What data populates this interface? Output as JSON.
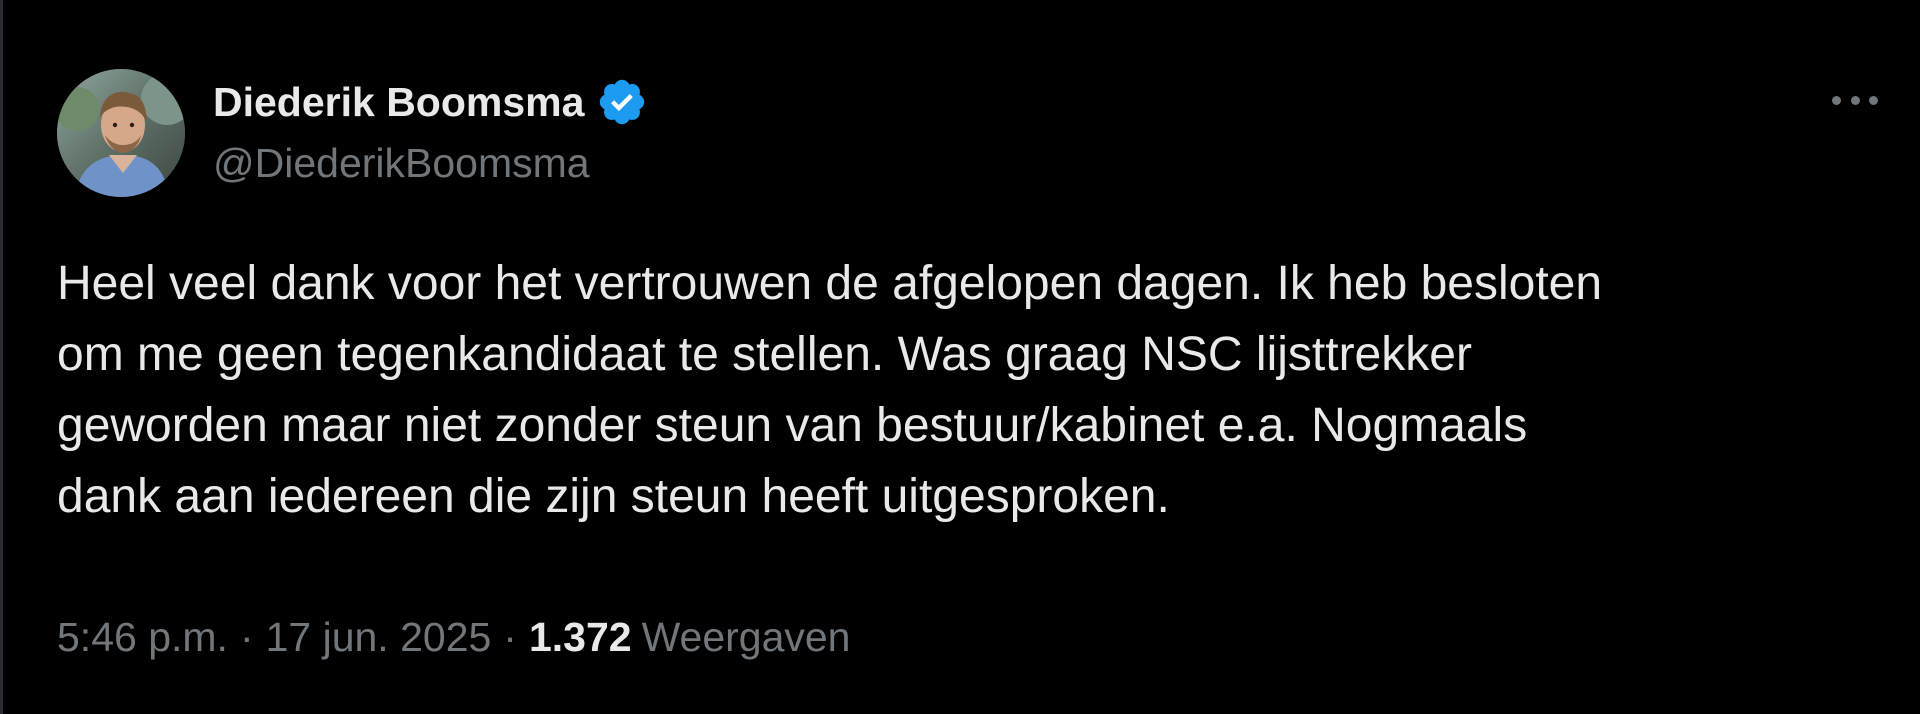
{
  "author": {
    "name": "Diederik Boomsma",
    "handle": "@DiederikBoomsma",
    "verified": true,
    "verified_color": "#1d9bf0",
    "avatar_icon": "avatar-photo"
  },
  "tweet": {
    "lines": [
      "Heel veel dank voor het vertrouwen de afgelopen dagen. Ik heb besloten",
      "om me geen tegenkandidaat te stellen. Was graag NSC lijsttrekker",
      "geworden maar niet zonder steun van bestuur/kabinet e.a. Nogmaals",
      "dank aan iedereen die zijn steun heeft uitgesproken."
    ]
  },
  "meta": {
    "time": "5:46 p.m.",
    "separator": "·",
    "date": "17 jun. 2025",
    "views_count": "1.372",
    "views_label": "Weergaven"
  },
  "more_icon": "more-horizontal-icon",
  "colors": {
    "background": "#000000",
    "primary_text": "#e7e9ea",
    "secondary_text": "#71767b",
    "accent": "#1d9bf0"
  }
}
